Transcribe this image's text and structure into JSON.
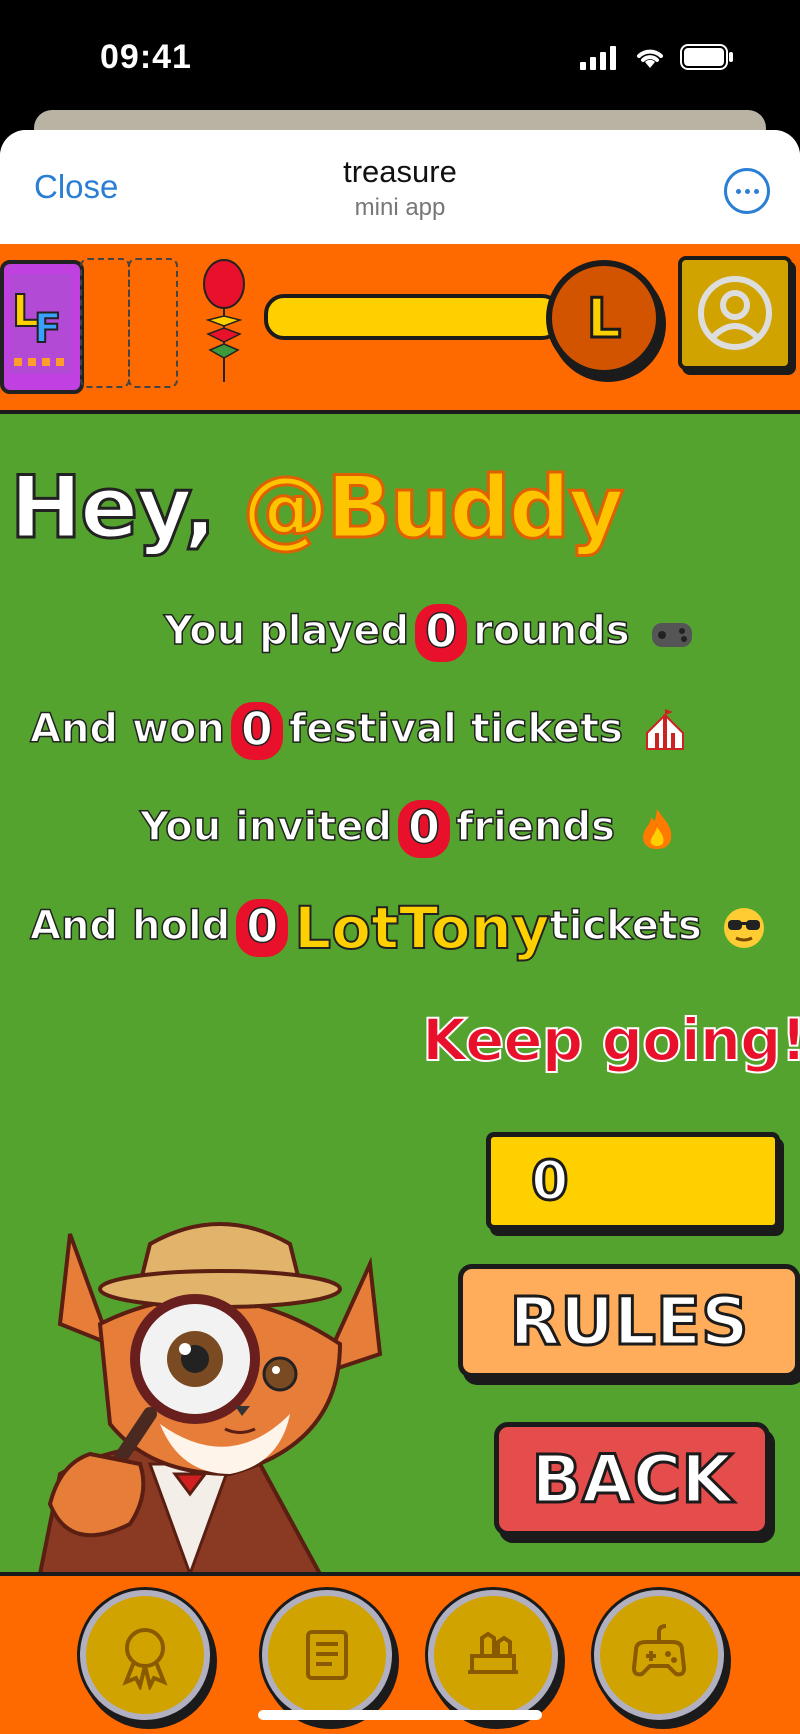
{
  "status_bar": {
    "time": "09:41"
  },
  "nav": {
    "close_label": "Close",
    "title": "treasure",
    "subtitle": "mini app"
  },
  "top_bar": {
    "ticket_label": "LF",
    "level_label": "L",
    "progress": 1.0,
    "icons": [
      "ticket-icon",
      "balloon-icon",
      "level-badge-icon",
      "user-profile-icon"
    ]
  },
  "greeting": {
    "prefix": "Hey,",
    "username": "@Buddy"
  },
  "stats": {
    "rounds": {
      "before": "You played",
      "value": "0",
      "after": "rounds"
    },
    "festival": {
      "before": "And won",
      "value": "0",
      "after": "festival tickets"
    },
    "friends": {
      "before": "You invited",
      "value": "0",
      "after": "friends"
    },
    "lottony": {
      "before": "And hold",
      "value": "0",
      "brand": "LotTony",
      "after": "tickets"
    }
  },
  "keep_going": "Keep going!",
  "counter_value": "0",
  "buttons": {
    "rules": "RULES",
    "back": "BACK"
  },
  "bottom_nav": [
    "award-icon",
    "scroll-icon",
    "shop-icon",
    "gamepad-icon"
  ],
  "colors": {
    "orange": "#ff6a00",
    "green": "#55a32f",
    "yellow": "#ffd000",
    "red": "#e8102a",
    "gold": "#d1a300"
  }
}
